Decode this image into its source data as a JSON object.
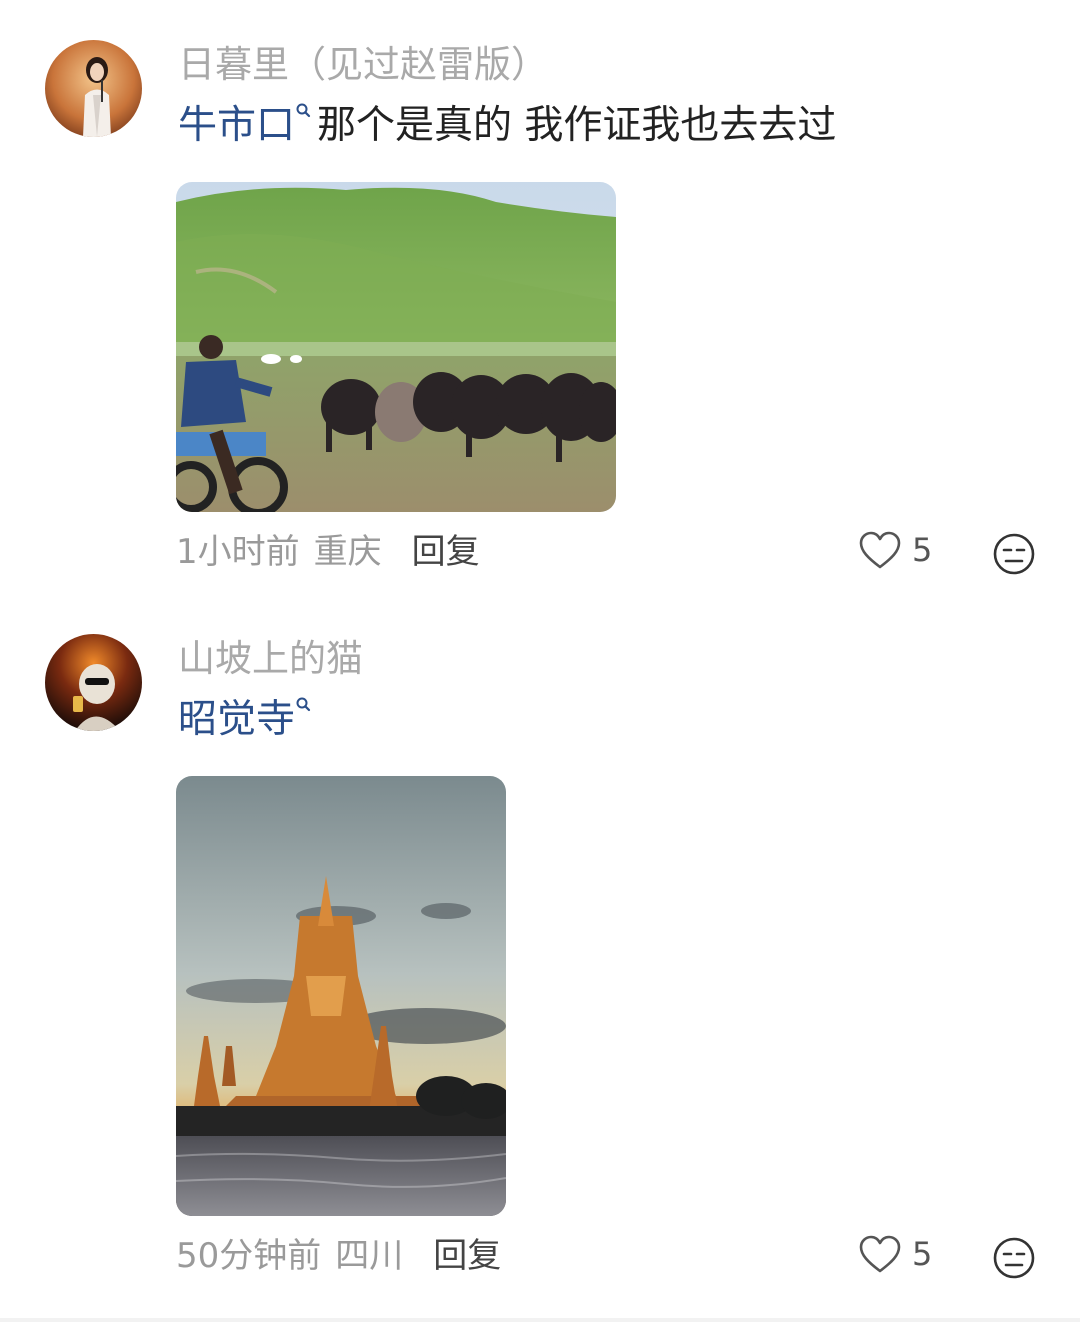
{
  "comments": [
    {
      "username": "日暮里（见过赵雷版）",
      "content_link": "牛市口",
      "content_text": "那个是真的 我作证我也去去过",
      "image": "yaks-grassland-photo",
      "time": "1小时前",
      "location": "重庆",
      "reply_label": "回复",
      "likes": "5"
    },
    {
      "username": "山坡上的猫",
      "content_link": "昭觉寺",
      "content_text": "",
      "image": "temple-sunset-photo",
      "time": "50分钟前",
      "location": "四川",
      "reply_label": "回复",
      "likes": "5"
    }
  ],
  "icons": {
    "like": "heart-icon",
    "dislike": "meh-face-icon",
    "search": "search-icon"
  },
  "colors": {
    "username": "#a9a9a9",
    "link": "#2b4f8a",
    "meta": "#9a9a9a",
    "text": "#222222"
  }
}
